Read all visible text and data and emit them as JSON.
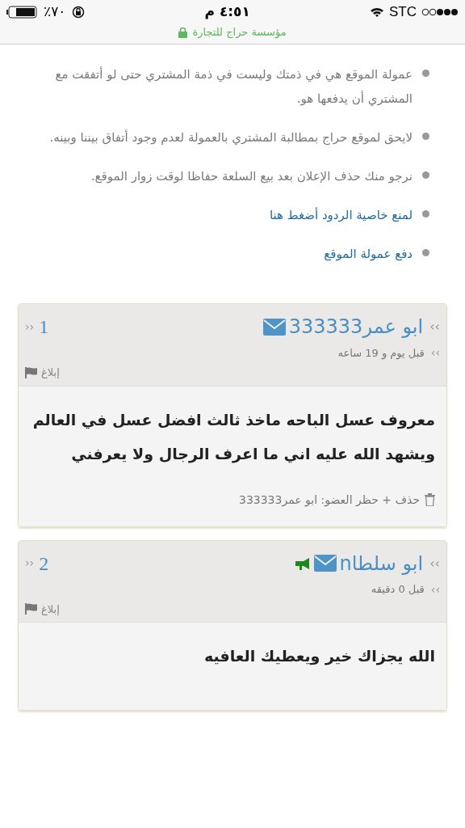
{
  "status_bar": {
    "carrier": "STC",
    "time": "٤:٥١ م",
    "battery": "٪٧٠"
  },
  "address_bar": {
    "title": "مؤسسة حراج للتجارة",
    "secure": true
  },
  "notes": [
    {
      "kind": "text",
      "text": "عمولة الموقع هي في ذمتك وليست في ذمة المشتري حتى لو أتفقت مع المشتري أن يدفعها هو."
    },
    {
      "kind": "text",
      "text": "لايحق لموقع حراج بمطالبة المشتري بالعمولة لعدم وجود أتفاق بيننا وبينه."
    },
    {
      "kind": "text",
      "text": "نرجو منك حذف الإعلان بعد بيع السلعة حفاظا لوقت زوار الموقع."
    },
    {
      "kind": "link",
      "text": "لمنع خاصية الردود أضغط هنا"
    },
    {
      "kind": "link",
      "text": "دفع عمولة الموقع"
    }
  ],
  "posts": [
    {
      "author_mark": "››",
      "author": "ابو عمر333333",
      "mail": true,
      "megaphone": false,
      "number_mark": "››",
      "number": "1",
      "time_mark": "››",
      "time": "قبل يوم و 19 ساعه",
      "report": "إبلاغ",
      "body": [
        "معروف عسل الباحه ماخذ ثالث افضل عسل في العالم",
        "ويشهد الله عليه اني ما اعرف الرجال ولا يعرفني"
      ],
      "admin_action": "حذف + حظر العضو: ابو عمر333333"
    },
    {
      "author_mark": "››",
      "author": "ابو سلطاn",
      "mail": true,
      "megaphone": true,
      "number_mark": "››",
      "number": "2",
      "time_mark": "››",
      "time": "قبل 0 دقيقه",
      "report": "إبلاغ",
      "body": [
        "الله يجزاك خير ويعطيك العافيه"
      ]
    }
  ]
}
